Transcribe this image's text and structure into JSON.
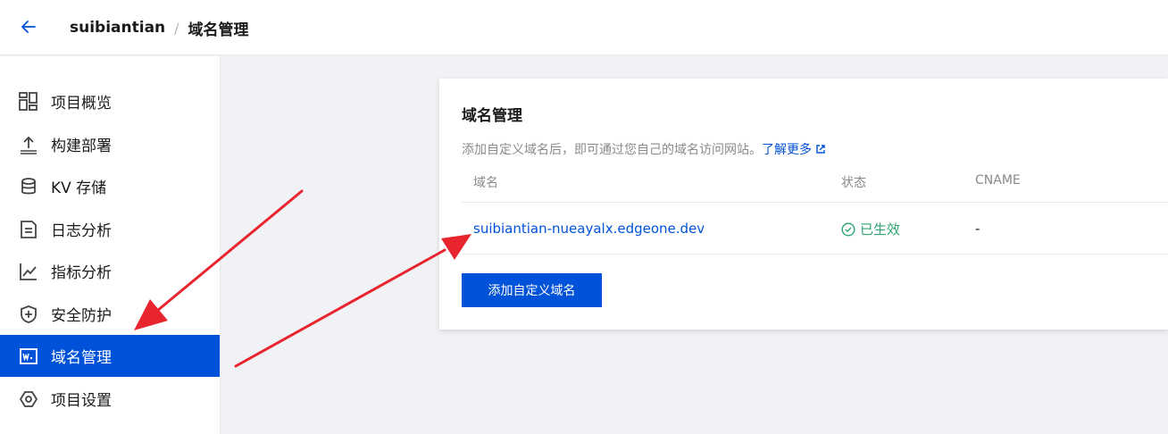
{
  "header": {
    "project": "suibiantian",
    "separator": "/",
    "current": "域名管理"
  },
  "sidebar": {
    "items": [
      {
        "label": "项目概览",
        "icon": "dashboard-icon"
      },
      {
        "label": "构建部署",
        "icon": "upload-icon"
      },
      {
        "label": "KV 存储",
        "icon": "database-icon"
      },
      {
        "label": "日志分析",
        "icon": "document-icon"
      },
      {
        "label": "指标分析",
        "icon": "chart-icon"
      },
      {
        "label": "安全防护",
        "icon": "shield-icon"
      },
      {
        "label": "域名管理",
        "icon": "domain-icon",
        "active": true
      },
      {
        "label": "项目设置",
        "icon": "settings-icon"
      }
    ]
  },
  "main": {
    "title": "域名管理",
    "description": "添加自定义域名后，即可通过您自己的域名访问网站。",
    "learn_more": "了解更多",
    "table": {
      "headers": [
        "域名",
        "状态",
        "CNAME"
      ],
      "rows": [
        {
          "domain": "suibiantian-nueayalx.edgeone.dev",
          "status": "已生效",
          "cname": "-"
        }
      ]
    },
    "add_button": "添加自定义域名"
  },
  "colors": {
    "primary": "#0052d9",
    "success": "#2ba471",
    "annotation": "#e8242e"
  }
}
